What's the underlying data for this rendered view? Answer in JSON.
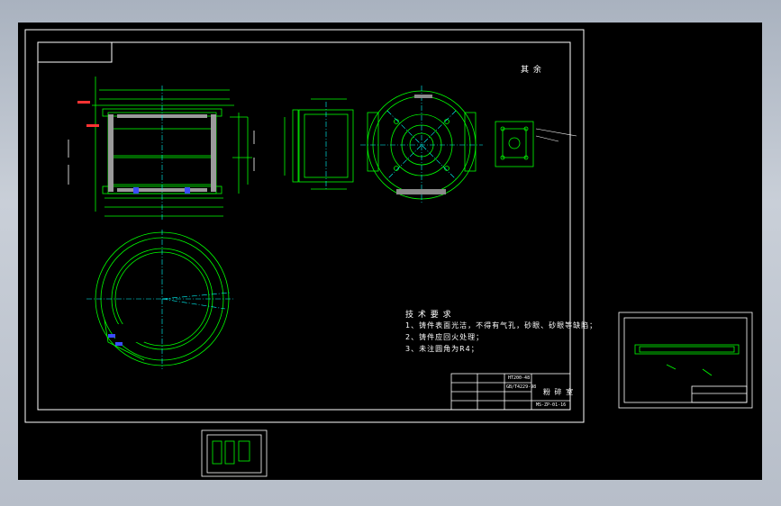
{
  "drawing": {
    "title_text": "技 术 要 求",
    "notes": [
      "1、铸件表面光洁，不得有气孔，砂眼、砂眼等缺陷；",
      "2、铸件应回火处理；",
      "3、未注圆角为R4；"
    ],
    "other_label": "其 余",
    "part_name": "粉 碎 室",
    "drawing_no": "MS-ZP-01-16",
    "material": "HT200-48",
    "scale_label": "GB/T4229-98"
  },
  "colors": {
    "background": "#000000",
    "frame": "#ffffff",
    "geometry": "#00ff00",
    "centerline": "#00ffff",
    "dimension": "#ff3333",
    "highlight": "#3b4cff"
  }
}
